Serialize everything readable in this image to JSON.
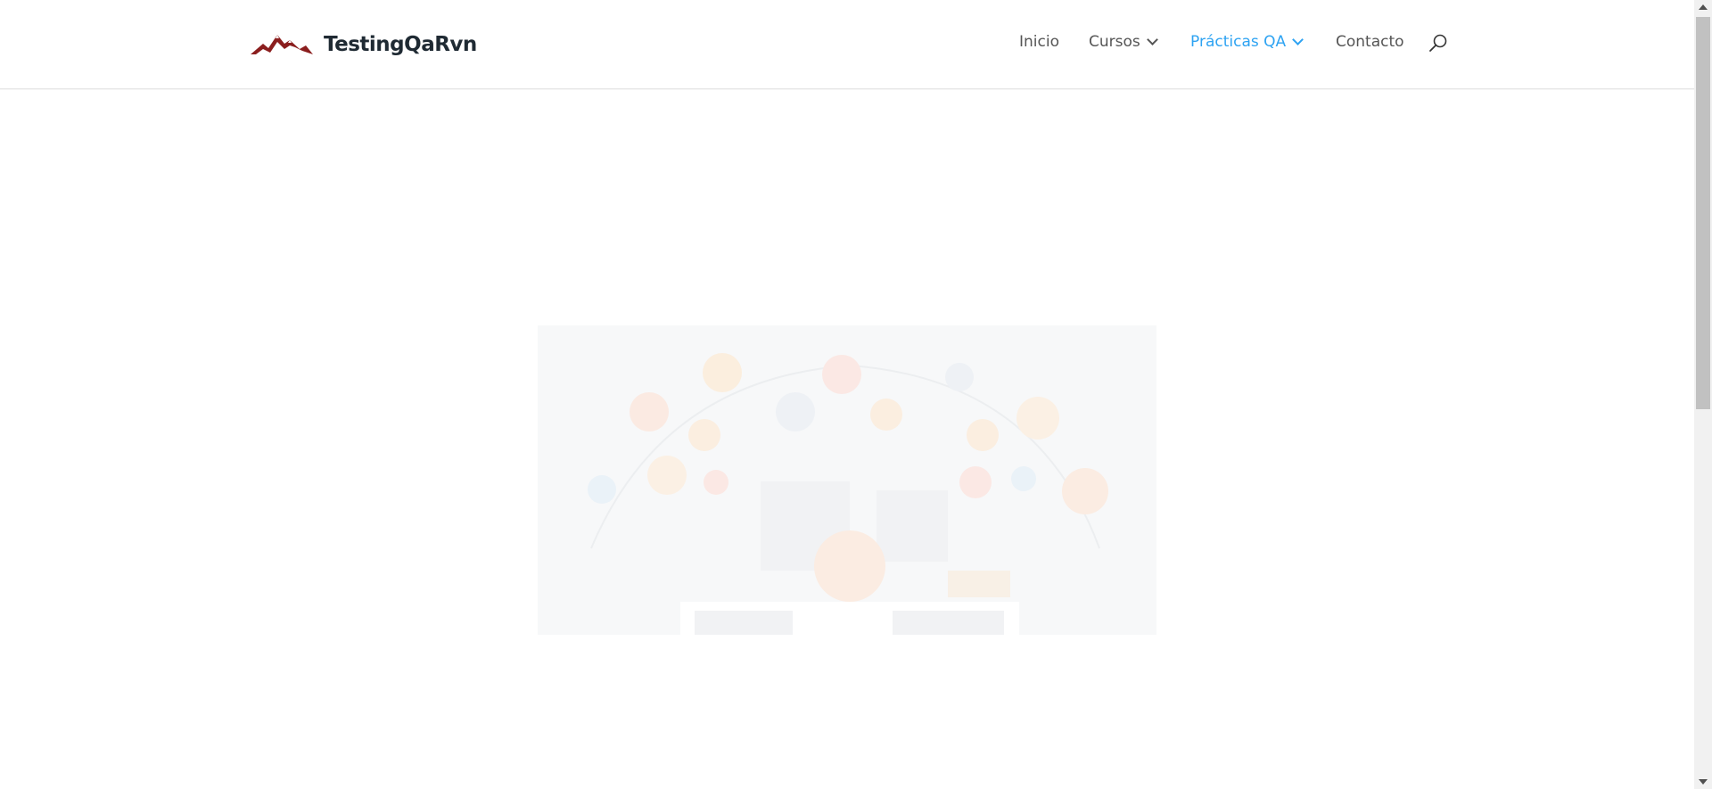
{
  "site": {
    "logo_text": "TestingQaRvn"
  },
  "nav": {
    "items": [
      {
        "label": "Inicio",
        "has_dropdown": false,
        "active": false
      },
      {
        "label": "Cursos",
        "has_dropdown": true,
        "active": false
      },
      {
        "label": "Prácticas QA",
        "has_dropdown": true,
        "active": true
      },
      {
        "label": "Contacto",
        "has_dropdown": false,
        "active": false
      }
    ],
    "search_icon": "search-icon"
  },
  "colors": {
    "accent": "#2ea3f2",
    "nav_text": "#555555",
    "logo_text": "#1f2a33",
    "logo_mountain": "#8b1e1e"
  },
  "hero": {
    "image_icon": "qa-testing-illustration"
  }
}
